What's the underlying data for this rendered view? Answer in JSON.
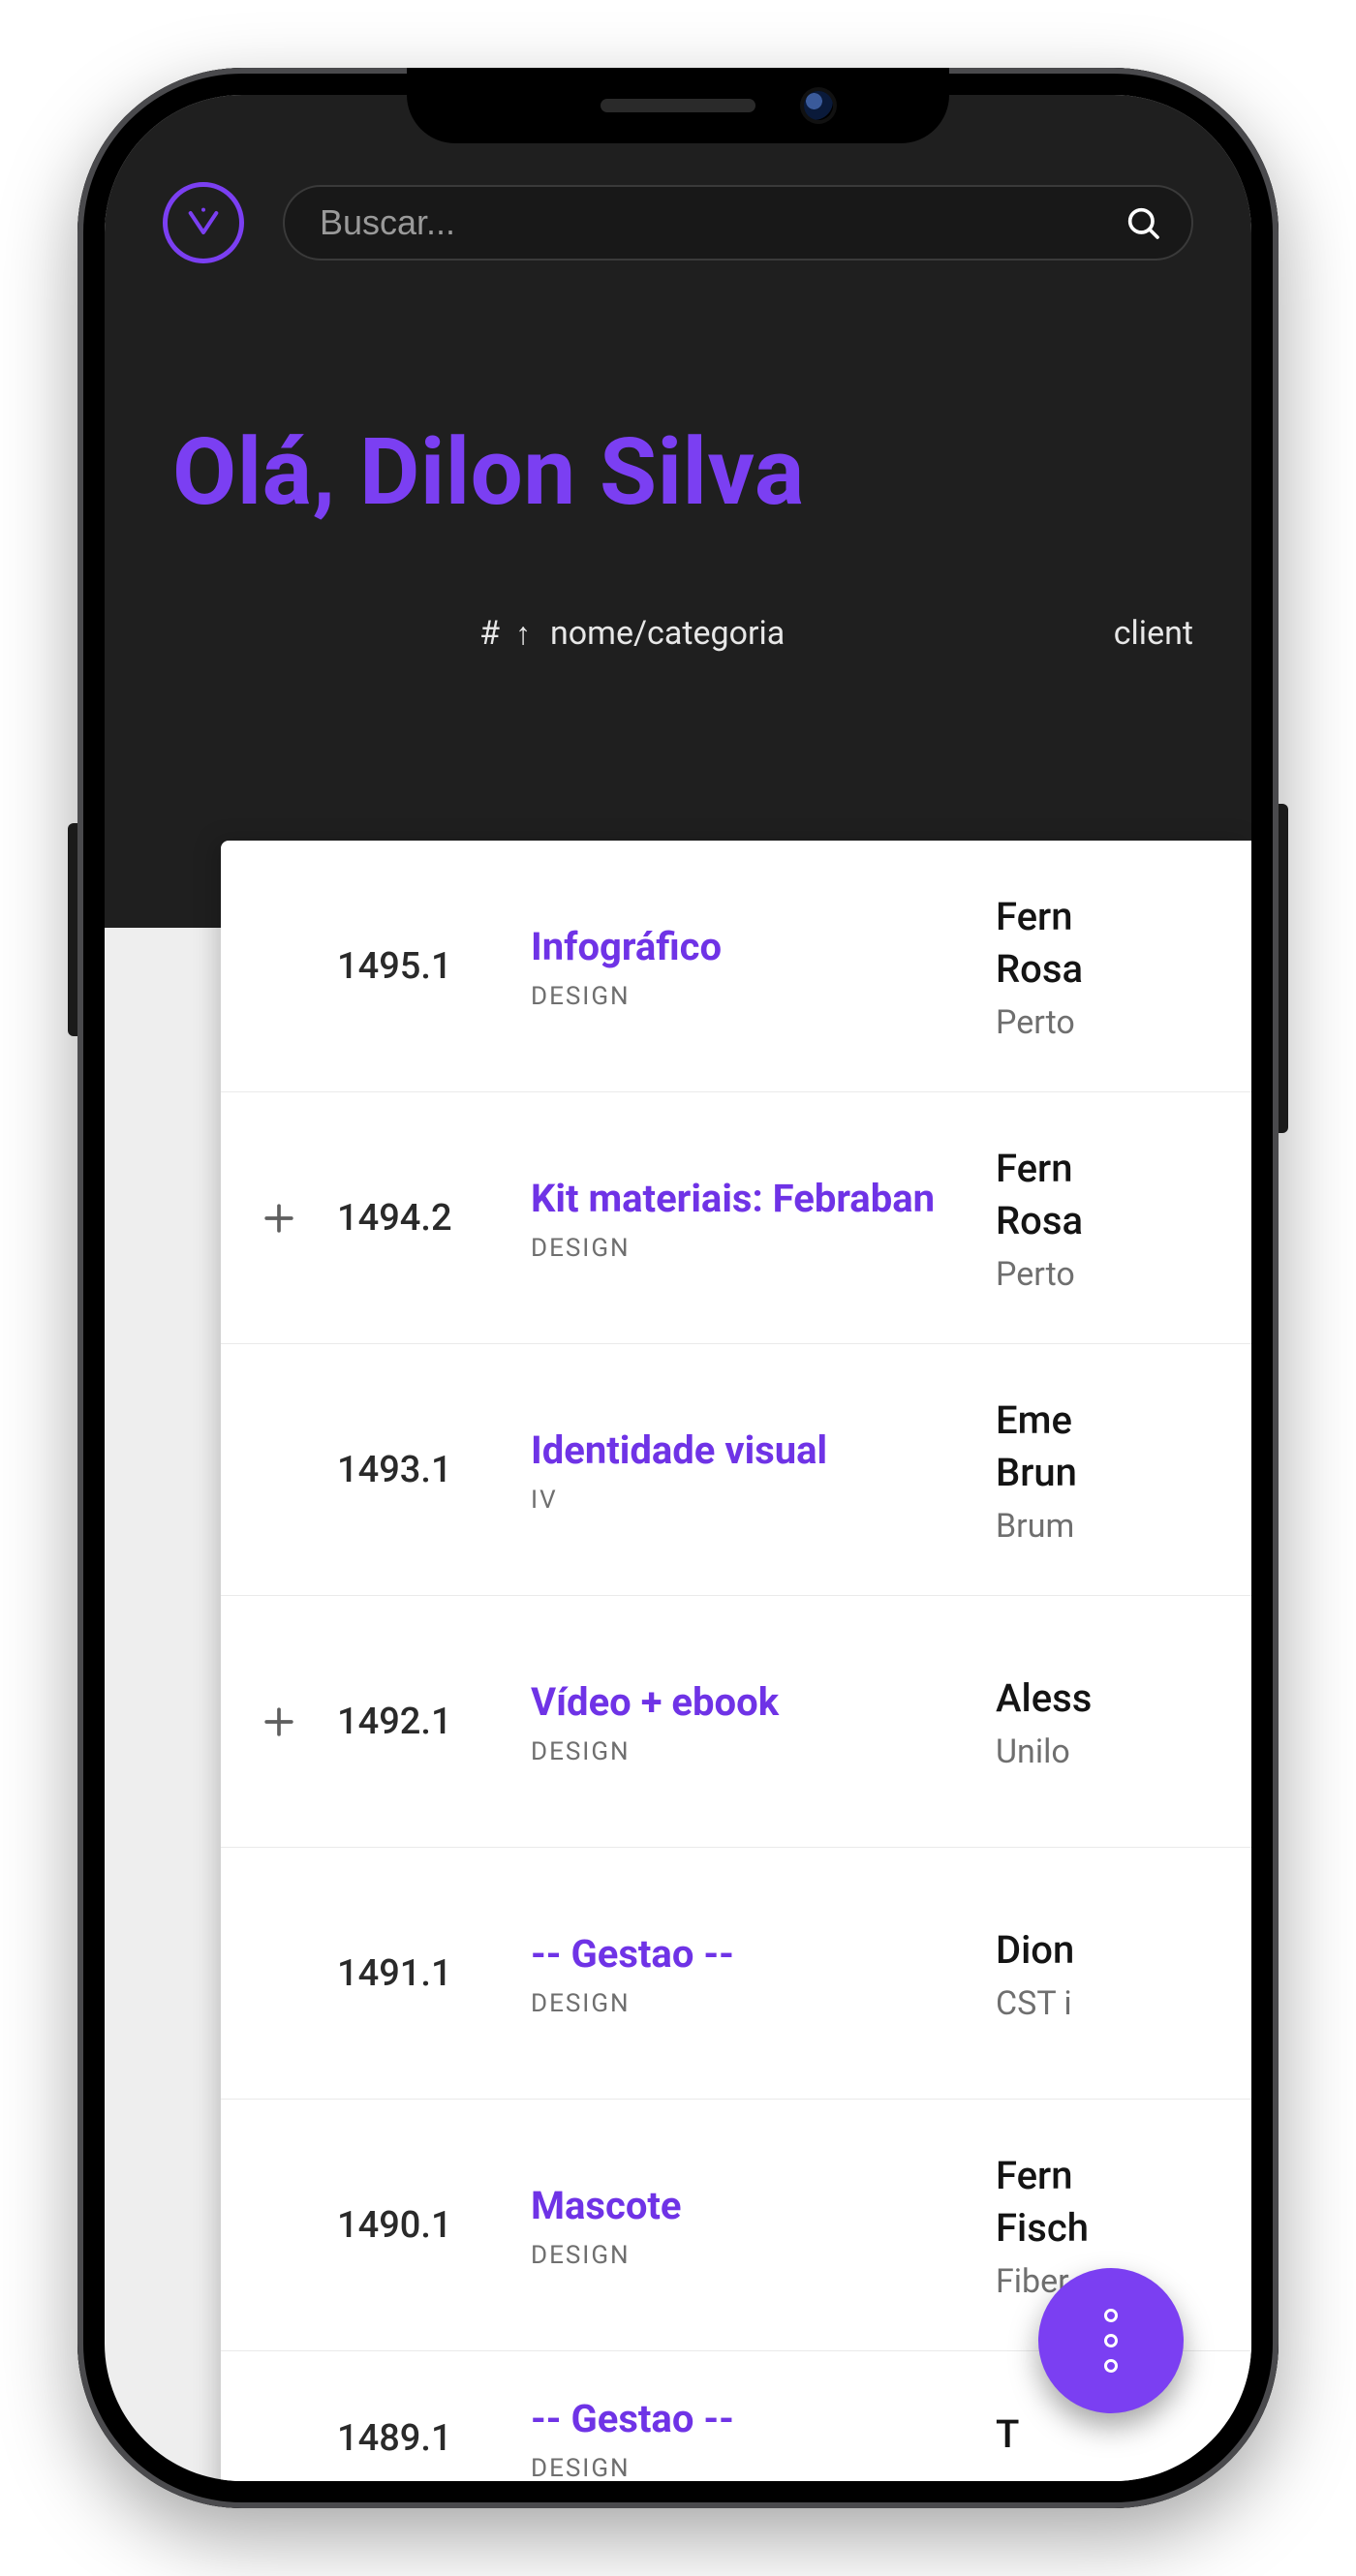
{
  "colors": {
    "accent": "#7b3ff2",
    "headerBg": "#1f1f1f",
    "pageBg": "#eeeeee"
  },
  "search": {
    "placeholder": "Buscar..."
  },
  "greeting": "Olá, Dilon Silva",
  "table": {
    "headers": {
      "id": "#",
      "sort_icon": "↑",
      "name": "nome/categoria",
      "client": "client"
    },
    "rows": [
      {
        "expandable": false,
        "id": "1495.1",
        "name": "Infográfico",
        "category": "DESIGN",
        "client_l1": "Fern",
        "client_l2": "Rosa",
        "client_sub": "Perto"
      },
      {
        "expandable": true,
        "id": "1494.2",
        "name": "Kit materiais: Febraban",
        "category": "DESIGN",
        "client_l1": "Fern",
        "client_l2": "Rosa",
        "client_sub": "Perto"
      },
      {
        "expandable": false,
        "id": "1493.1",
        "name": "Identidade visual",
        "category": "IV",
        "client_l1": "Eme",
        "client_l2": "Brun",
        "client_sub": "Brum"
      },
      {
        "expandable": true,
        "id": "1492.1",
        "name": "Vídeo + ebook",
        "category": "DESIGN",
        "client_l1": "Aless",
        "client_l2": "",
        "client_sub": "Unilo"
      },
      {
        "expandable": false,
        "id": "1491.1",
        "name": "-- Gestao --",
        "category": "DESIGN",
        "client_l1": "Dion",
        "client_l2": "",
        "client_sub": "CST i"
      },
      {
        "expandable": false,
        "id": "1490.1",
        "name": "Mascote",
        "category": "DESIGN",
        "client_l1": "Fern",
        "client_l2": "Fisch",
        "client_sub": "Fiber"
      },
      {
        "expandable": false,
        "id": "1489.1",
        "name": "-- Gestao --",
        "category": "DESIGN",
        "client_l1": "T",
        "client_l2": "",
        "client_sub": ""
      }
    ]
  }
}
